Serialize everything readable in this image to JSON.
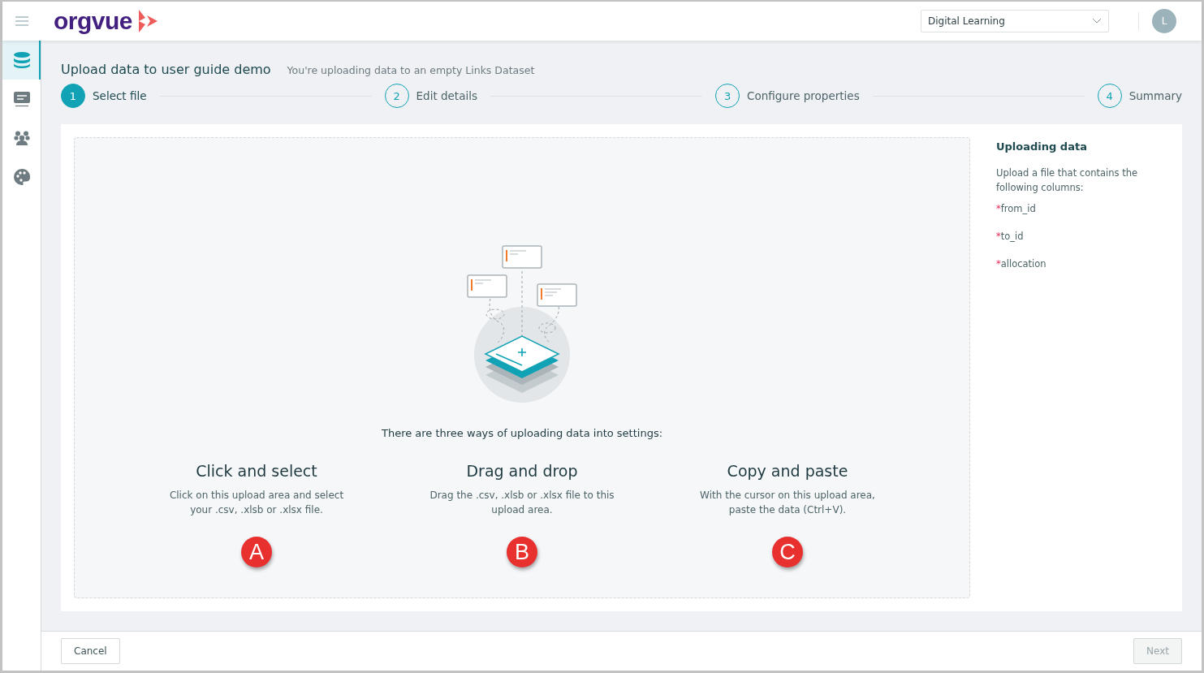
{
  "header": {
    "logo": "orgvue",
    "workspace": {
      "value": "Digital Learning"
    },
    "avatar": "L"
  },
  "sidebar": {
    "items": [
      {
        "kind": "database",
        "selected": true
      },
      {
        "kind": "panel",
        "selected": false
      },
      {
        "kind": "people",
        "selected": false
      },
      {
        "kind": "palette",
        "selected": false
      }
    ]
  },
  "page": {
    "title": "Upload data to user guide demo",
    "subtitle": "You're uploading data to an empty Links Dataset"
  },
  "steps": [
    {
      "number": "1",
      "label": "Select file",
      "selected": true
    },
    {
      "number": "2",
      "label": "Edit details",
      "selected": false
    },
    {
      "number": "3",
      "label": "Configure properties",
      "selected": false
    },
    {
      "number": "4",
      "label": "Summary",
      "selected": false
    }
  ],
  "upload_area": {
    "intro": "There are three ways of uploading data into settings:",
    "methods": [
      {
        "title": "Click and select",
        "text": "Click on this upload area and select your .csv, .xlsb or .xlsx file.",
        "callout": "A"
      },
      {
        "title": "Drag and drop",
        "text": "Drag the .csv, .xlsb or .xlsx file to this upload area.",
        "callout": "B"
      },
      {
        "title": "Copy and paste",
        "text": "With the cursor on this upload area, paste the data (Ctrl+V).",
        "callout": "C"
      }
    ]
  },
  "info_panel": {
    "title": "Uploading data",
    "text": "Upload a file that contains the following columns:",
    "columns": [
      {
        "mark": "*",
        "name": "from_id"
      },
      {
        "mark": "*",
        "name": "to_id"
      },
      {
        "mark": "*",
        "name": "allocation"
      }
    ]
  },
  "footer": {
    "cancel": {
      "label": "Cancel",
      "disabled": false
    },
    "next": {
      "label": "Next",
      "disabled": true
    }
  }
}
